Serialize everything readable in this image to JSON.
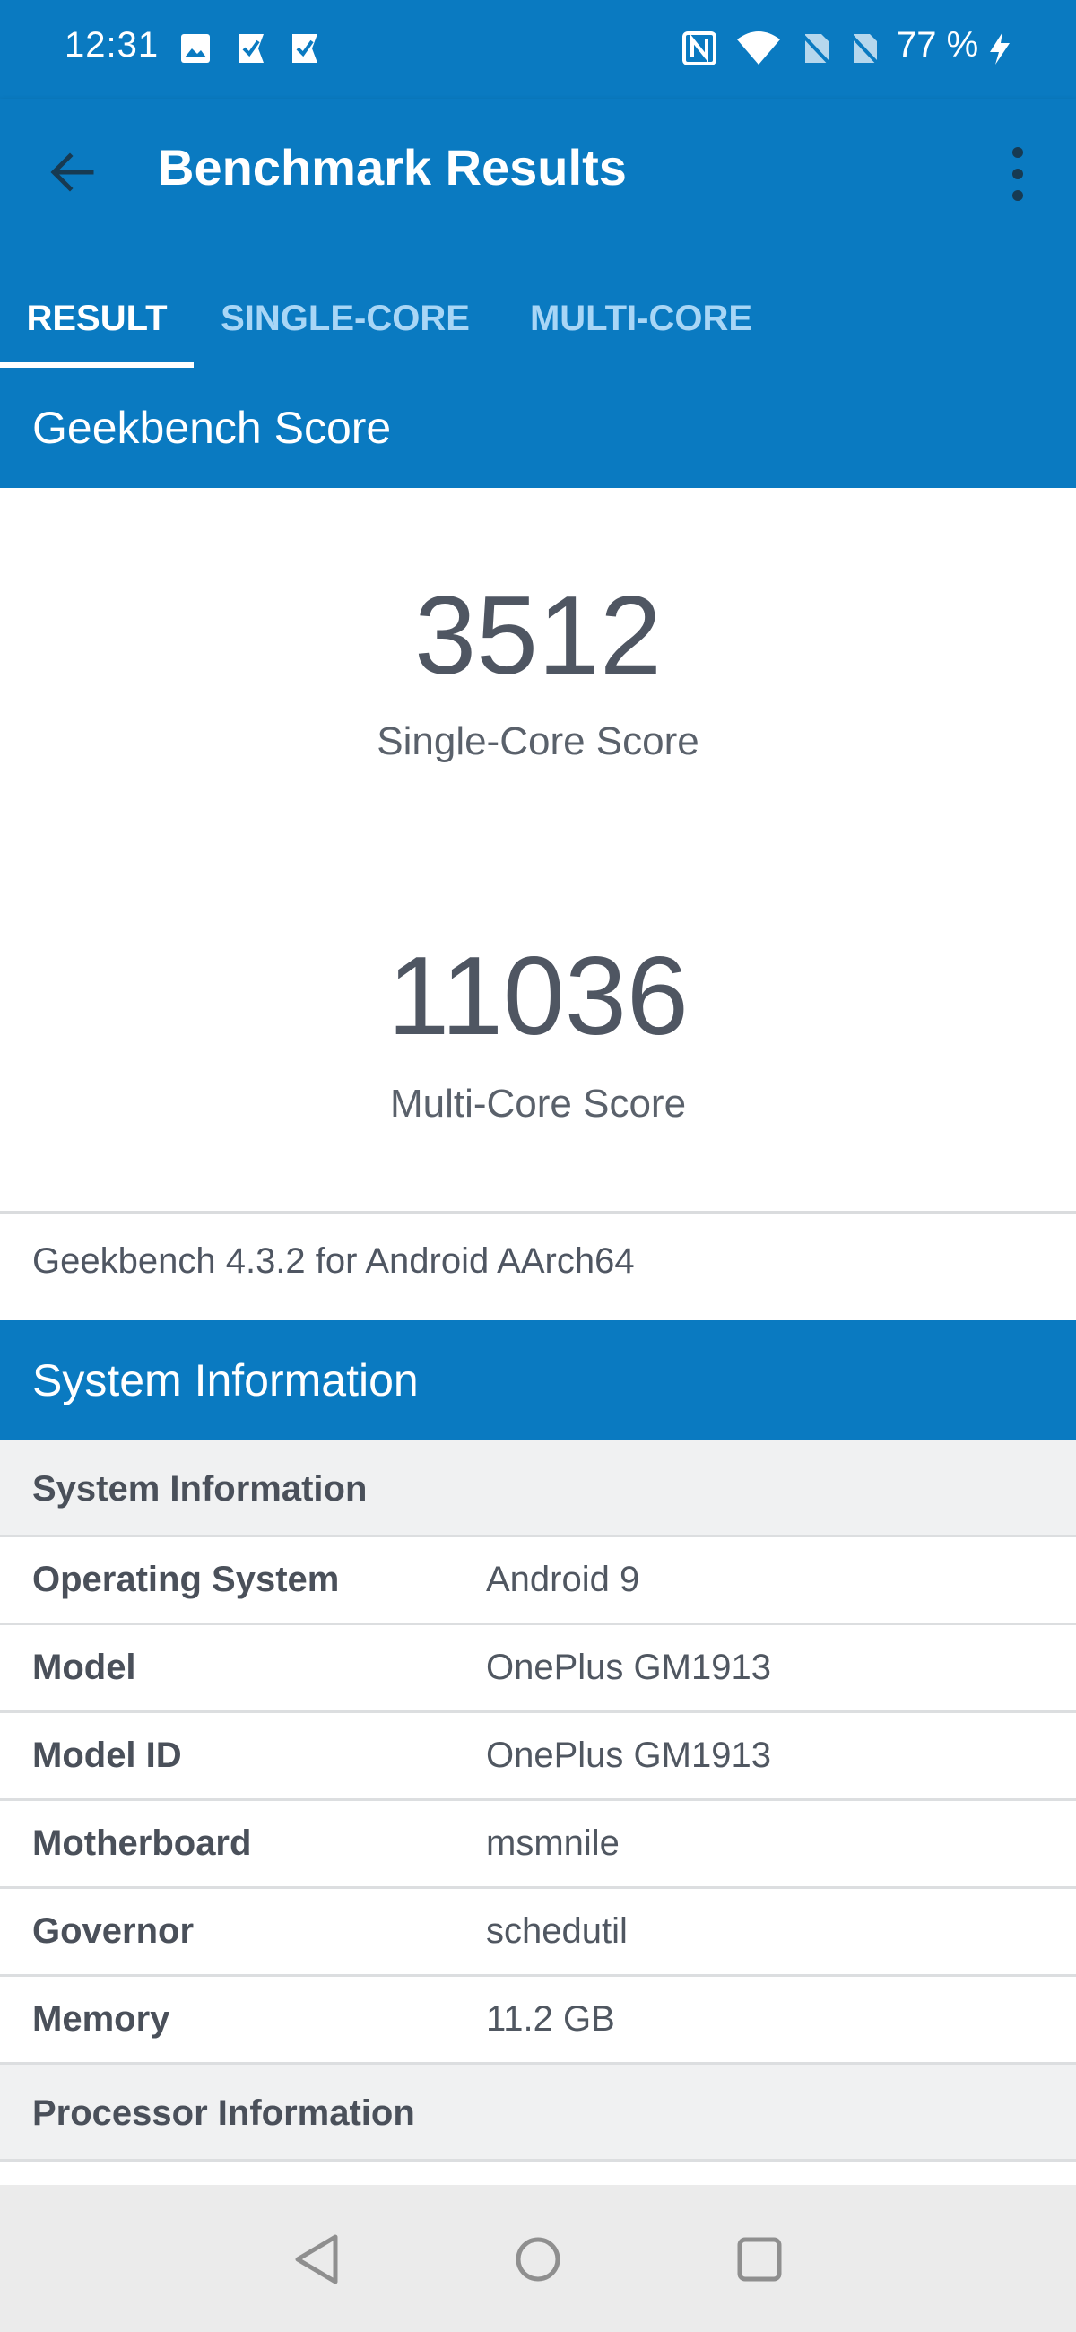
{
  "status_bar": {
    "time": "12:31",
    "battery": "77 %",
    "icons": [
      "image-icon",
      "check-flag-icon",
      "check-flag-icon",
      "nfc-icon",
      "wifi-icon",
      "no-sim-icon",
      "no-sim-icon",
      "charging-icon"
    ]
  },
  "app_bar": {
    "title": "Benchmark Results",
    "back_icon": "arrow-left-icon",
    "menu_icon": "more-vert-icon"
  },
  "tabs": [
    {
      "label": "RESULT",
      "active": true
    },
    {
      "label": "SINGLE-CORE",
      "active": false
    },
    {
      "label": "MULTI-CORE",
      "active": false
    }
  ],
  "score_section": {
    "header": "Geekbench Score",
    "single_core_value": "3512",
    "single_core_label": "Single-Core Score",
    "multi_core_value": "11036",
    "multi_core_label": "Multi-Core Score",
    "version": "Geekbench 4.3.2 for Android AArch64"
  },
  "system_section": {
    "header": "System Information",
    "group_label": "System Information",
    "rows": [
      {
        "key": "Operating System",
        "value": "Android 9"
      },
      {
        "key": "Model",
        "value": "OnePlus GM1913"
      },
      {
        "key": "Model ID",
        "value": "OnePlus GM1913"
      },
      {
        "key": "Motherboard",
        "value": "msmnile"
      },
      {
        "key": "Governor",
        "value": "schedutil"
      },
      {
        "key": "Memory",
        "value": "11.2 GB"
      }
    ],
    "next_group_label": "Processor Information"
  },
  "colors": {
    "primary": "#0a7ac1",
    "tab_inactive": "#a8d6f6",
    "text": "#4f5662",
    "group_bg": "#f0f1f2",
    "nav_bg": "#ebebeb"
  },
  "nav_bar": {
    "buttons": [
      "back-triangle-icon",
      "home-circle-icon",
      "recents-square-icon"
    ]
  }
}
